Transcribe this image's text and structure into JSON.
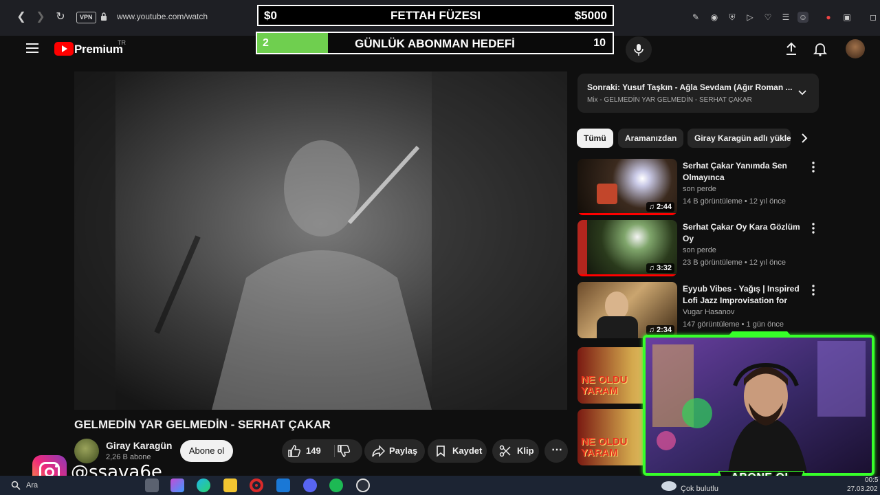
{
  "browser": {
    "vpn_label": "VPN",
    "url": "www.youtube.com/watch"
  },
  "goal_overlay": {
    "top_left": "$0",
    "top_title": "FETTAH FÜZESI",
    "top_right": "$5000",
    "bottom_left": "2",
    "bottom_title": "GÜNLÜK ABONMAN HEDEFİ",
    "bottom_right": "10",
    "progress_fraction": 0.2,
    "accent": "#6fcf4f"
  },
  "youtube_header": {
    "logo_text": "Premium",
    "region": "TR",
    "brand_color": "#ff0000"
  },
  "video": {
    "title": "GELMEDİN YAR GELMEDİN - SERHAT ÇAKAR",
    "channel_name": "Giray Karagün",
    "channel_subs": "2,26 B abone",
    "subscribe_label": "Abone ol",
    "like_count": "149",
    "share_label": "Paylaş",
    "save_label": "Kaydet",
    "clip_label": "Klip"
  },
  "up_next": {
    "title": "Sonraki: Yusuf Taşkın - Ağla Sevdam (Ağır Roman ...",
    "subtitle": "Mix - GELMEDİN YAR GELMEDİN - SERHAT ÇAKAR"
  },
  "filter_chips": [
    "Tümü",
    "Aramanızdan",
    "Giray Karagün adlı yükle"
  ],
  "recommendations": [
    {
      "title": "Serhat Çakar Yanımda Sen Olmayınca",
      "channel": "son perde",
      "meta": "14 B görüntüleme • 12 yıl önce",
      "duration": "2:44"
    },
    {
      "title": "Serhat Çakar Oy Kara Gözlüm Oy",
      "channel": "son perde",
      "meta": "23 B görüntüleme • 12 yıl önce",
      "duration": "3:32"
    },
    {
      "title": "Eyyub Vibes - Yağış | Inspired Lofi Jazz Improvisation for Lat...",
      "channel": "Vugar Hasanov",
      "meta": "147 görüntüleme • 1 gün önce",
      "duration": "2:34"
    },
    {
      "thumb_text": "NE OLDU YARAM"
    },
    {
      "thumb_text": "NE OLDU YARAM"
    }
  ],
  "webcam": {
    "banner": "ABONE OL",
    "accent": "#37ff2a"
  },
  "instagram": {
    "handle": "@ssava6e"
  },
  "taskbar": {
    "search_label": "Ara",
    "weather": "Çok bulutlu",
    "time": "00:5",
    "date": "27.03.202"
  }
}
